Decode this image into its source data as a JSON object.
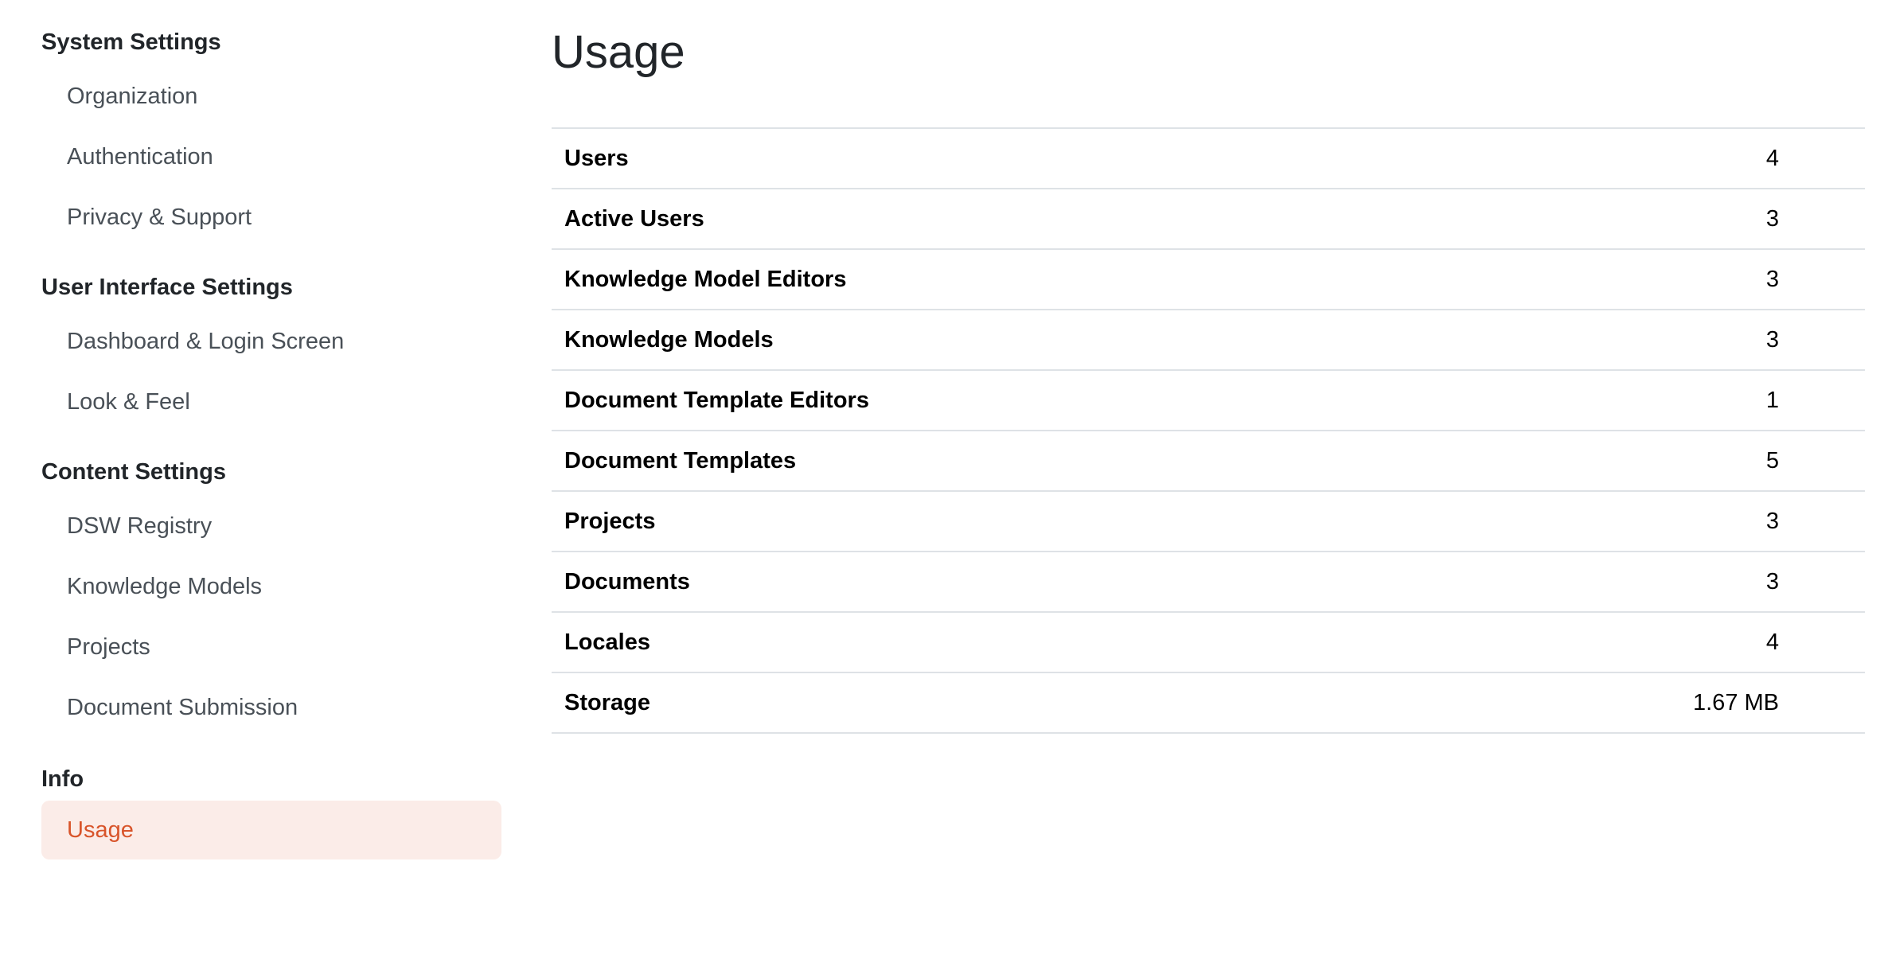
{
  "sidebar": {
    "sections": [
      {
        "title": "System Settings",
        "items": [
          "Organization",
          "Authentication",
          "Privacy & Support"
        ]
      },
      {
        "title": "User Interface Settings",
        "items": [
          "Dashboard & Login Screen",
          "Look & Feel"
        ]
      },
      {
        "title": "Content Settings",
        "items": [
          "DSW Registry",
          "Knowledge Models",
          "Projects",
          "Document Submission"
        ]
      },
      {
        "title": "Info",
        "items": [
          "Usage"
        ]
      }
    ],
    "active_item": "Usage"
  },
  "main": {
    "title": "Usage",
    "rows": [
      {
        "label": "Users",
        "value": "4"
      },
      {
        "label": "Active Users",
        "value": "3"
      },
      {
        "label": "Knowledge Model Editors",
        "value": "3"
      },
      {
        "label": "Knowledge Models",
        "value": "3"
      },
      {
        "label": "Document Template Editors",
        "value": "1"
      },
      {
        "label": "Document Templates",
        "value": "5"
      },
      {
        "label": "Projects",
        "value": "3"
      },
      {
        "label": "Documents",
        "value": "3"
      },
      {
        "label": "Locales",
        "value": "4"
      },
      {
        "label": "Storage",
        "value": "1.67 MB"
      }
    ]
  },
  "colors": {
    "active_bg": "#fbece8",
    "active_text": "#d8542a",
    "nav_text": "#495057",
    "divider": "#dee2e6"
  }
}
